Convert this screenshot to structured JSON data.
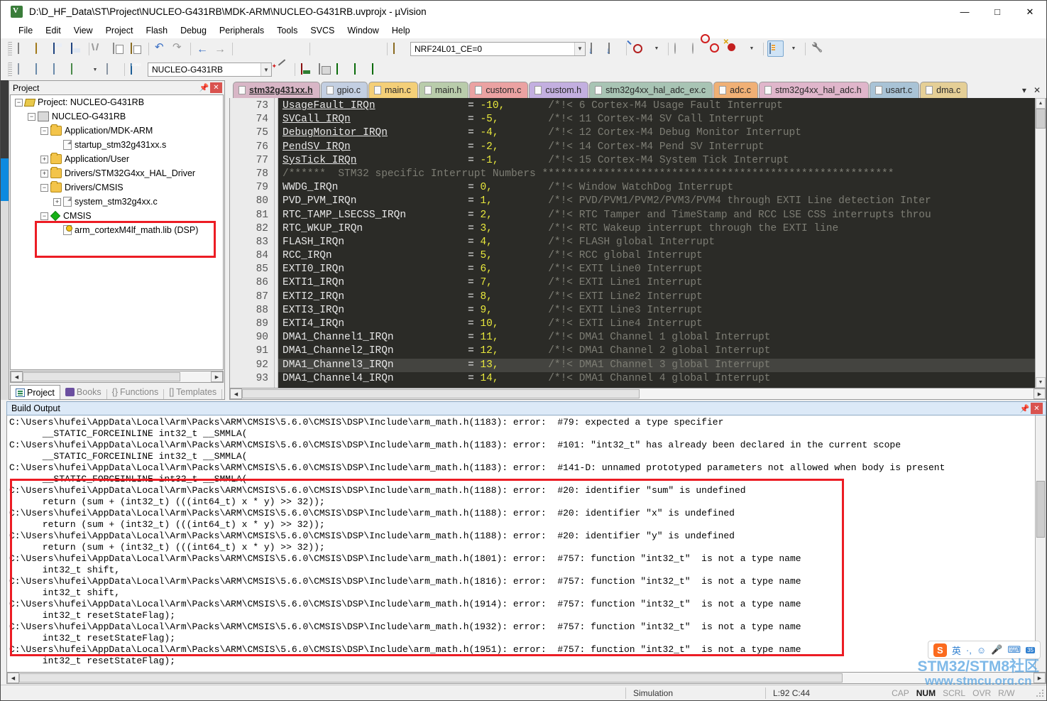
{
  "window": {
    "title": "D:\\D_HF_Data\\ST\\Project\\NUCLEO-G431RB\\MDK-ARM\\NUCLEO-G431RB.uvprojx - µVision",
    "minimize": "—",
    "maximize": "□",
    "close": "✕"
  },
  "menu": [
    {
      "label": "File"
    },
    {
      "label": "Edit"
    },
    {
      "label": "View"
    },
    {
      "label": "Project"
    },
    {
      "label": "Flash"
    },
    {
      "label": "Debug"
    },
    {
      "label": "Peripherals"
    },
    {
      "label": "Tools"
    },
    {
      "label": "SVCS"
    },
    {
      "label": "Window"
    },
    {
      "label": "Help"
    }
  ],
  "toolbar": {
    "target_combo_value": "NRF24L01_CE=0",
    "project_combo_value": "NUCLEO-G431RB",
    "arrow": "▼"
  },
  "project_pane": {
    "title": "Project",
    "pin_icon": "📌",
    "close_icon": "✕",
    "tree": [
      {
        "indent": 0,
        "toggle": "−",
        "icon": "project-icon",
        "label": "Project: NUCLEO-G431RB"
      },
      {
        "indent": 1,
        "toggle": "−",
        "icon": "projfolder-icon",
        "label": "NUCLEO-G431RB"
      },
      {
        "indent": 2,
        "toggle": "−",
        "icon": "folder-icon",
        "label": "Application/MDK-ARM"
      },
      {
        "indent": 3,
        "toggle": "",
        "icon": "file-icon",
        "label": "startup_stm32g431xx.s"
      },
      {
        "indent": 2,
        "toggle": "+",
        "icon": "folder-icon",
        "label": "Application/User"
      },
      {
        "indent": 2,
        "toggle": "+",
        "icon": "folder-icon",
        "label": "Drivers/STM32G4xx_HAL_Driver"
      },
      {
        "indent": 2,
        "toggle": "−",
        "icon": "folder-icon",
        "label": "Drivers/CMSIS"
      },
      {
        "indent": 3,
        "toggle": "+",
        "icon": "file-icon",
        "label": "system_stm32g4xx.c"
      },
      {
        "indent": 2,
        "toggle": "−",
        "icon": "diamond-icon",
        "label": "CMSIS"
      },
      {
        "indent": 3,
        "toggle": "",
        "icon": "lib-icon",
        "label": "arm_cortexM4lf_math.lib (DSP)"
      }
    ],
    "tabs": [
      {
        "label": "Project",
        "selected": true
      },
      {
        "label": "Books",
        "selected": false
      },
      {
        "label": "Functions",
        "selected": false
      },
      {
        "label": "Templates",
        "selected": false
      }
    ]
  },
  "editor": {
    "tabs": [
      {
        "label": "stm32g431xx.h",
        "color": "#d8b6c6",
        "selected": true
      },
      {
        "label": "gpio.c",
        "color": "#c3cfe2",
        "selected": false
      },
      {
        "label": "main.c",
        "color": "#f4cf78",
        "selected": false
      },
      {
        "label": "main.h",
        "color": "#b9ccab",
        "selected": false
      },
      {
        "label": "custom.c",
        "color": "#eba2a2",
        "selected": false
      },
      {
        "label": "custom.h",
        "color": "#c3afe0",
        "selected": false
      },
      {
        "label": "stm32g4xx_hal_adc_ex.c",
        "color": "#a8c4b4",
        "selected": false
      },
      {
        "label": "adc.c",
        "color": "#f0b075",
        "selected": false
      },
      {
        "label": "stm32g4xx_hal_adc.h",
        "color": "#e0b6cb",
        "selected": false
      },
      {
        "label": "usart.c",
        "color": "#a9c3d6",
        "selected": false
      },
      {
        "label": "dma.c",
        "color": "#e5cf96",
        "selected": false
      }
    ],
    "tab_overflow_icon": "▾",
    "tab_close_icon": "✕",
    "first_line_number": 73,
    "current_line": 92,
    "lines": [
      {
        "n": 73,
        "ident": "UsageFault_IRQn",
        "underline": true,
        "eq": "=",
        "num": "-10,",
        "comment": "/*!< 6 Cortex-M4 Usage Fault Interrupt"
      },
      {
        "n": 74,
        "ident": "SVCall_IRQn",
        "underline": true,
        "eq": "=",
        "num": "-5,",
        "comment": "/*!< 11 Cortex-M4 SV Call Interrupt"
      },
      {
        "n": 75,
        "ident": "DebugMonitor_IRQn",
        "underline": true,
        "eq": "=",
        "num": "-4,",
        "comment": "/*!< 12 Cortex-M4 Debug Monitor Interrupt"
      },
      {
        "n": 76,
        "ident": "PendSV_IRQn",
        "underline": true,
        "eq": "=",
        "num": "-2,",
        "comment": "/*!< 14 Cortex-M4 Pend SV Interrupt"
      },
      {
        "n": 77,
        "ident": "SysTick_IRQn",
        "underline": true,
        "eq": "=",
        "num": "-1,",
        "comment": "/*!< 15 Cortex-M4 System Tick Interrupt"
      },
      {
        "n": 78,
        "banner": "/******  STM32 specific Interrupt Numbers *********************************************************"
      },
      {
        "n": 79,
        "ident": "WWDG_IRQn",
        "underline": false,
        "eq": "=",
        "num": "0,",
        "comment": "/*!< Window WatchDog Interrupt"
      },
      {
        "n": 80,
        "ident": "PVD_PVM_IRQn",
        "underline": false,
        "eq": "=",
        "num": "1,",
        "comment": "/*!< PVD/PVM1/PVM2/PVM3/PVM4 through EXTI Line detection Inter"
      },
      {
        "n": 81,
        "ident": "RTC_TAMP_LSECSS_IRQn",
        "underline": false,
        "eq": "=",
        "num": "2,",
        "comment": "/*!< RTC Tamper and TimeStamp and RCC LSE CSS interrupts throu"
      },
      {
        "n": 82,
        "ident": "RTC_WKUP_IRQn",
        "underline": false,
        "eq": "=",
        "num": "3,",
        "comment": "/*!< RTC Wakeup interrupt through the EXTI line"
      },
      {
        "n": 83,
        "ident": "FLASH_IRQn",
        "underline": false,
        "eq": "=",
        "num": "4,",
        "comment": "/*!< FLASH global Interrupt"
      },
      {
        "n": 84,
        "ident": "RCC_IRQn",
        "underline": false,
        "eq": "=",
        "num": "5,",
        "comment": "/*!< RCC global Interrupt"
      },
      {
        "n": 85,
        "ident": "EXTI0_IRQn",
        "underline": false,
        "eq": "=",
        "num": "6,",
        "comment": "/*!< EXTI Line0 Interrupt"
      },
      {
        "n": 86,
        "ident": "EXTI1_IRQn",
        "underline": false,
        "eq": "=",
        "num": "7,",
        "comment": "/*!< EXTI Line1 Interrupt"
      },
      {
        "n": 87,
        "ident": "EXTI2_IRQn",
        "underline": false,
        "eq": "=",
        "num": "8,",
        "comment": "/*!< EXTI Line2 Interrupt"
      },
      {
        "n": 88,
        "ident": "EXTI3_IRQn",
        "underline": false,
        "eq": "=",
        "num": "9,",
        "comment": "/*!< EXTI Line3 Interrupt"
      },
      {
        "n": 89,
        "ident": "EXTI4_IRQn",
        "underline": false,
        "eq": "=",
        "num": "10,",
        "comment": "/*!< EXTI Line4 Interrupt"
      },
      {
        "n": 90,
        "ident": "DMA1_Channel1_IRQn",
        "underline": false,
        "eq": "=",
        "num": "11,",
        "comment": "/*!< DMA1 Channel 1 global Interrupt"
      },
      {
        "n": 91,
        "ident": "DMA1_Channel2_IRQn",
        "underline": false,
        "eq": "=",
        "num": "12,",
        "comment": "/*!< DMA1 Channel 2 global Interrupt"
      },
      {
        "n": 92,
        "ident": "DMA1_Channel3_IRQn",
        "underline": false,
        "eq": "=",
        "num": "13,",
        "comment": "/*!< DMA1 Channel 3 global Interrupt"
      },
      {
        "n": 93,
        "ident": "DMA1_Channel4_IRQn",
        "underline": false,
        "eq": "=",
        "num": "14,",
        "comment": "/*!< DMA1 Channel 4 global Interrupt"
      }
    ]
  },
  "build_output": {
    "title": "Build Output",
    "pin_icon": "📌",
    "close_icon": "✕",
    "lines": [
      "C:\\Users\\hufei\\AppData\\Local\\Arm\\Packs\\ARM\\CMSIS\\5.6.0\\CMSIS\\DSP\\Include\\arm_math.h(1183): error:  #79: expected a type specifier",
      "      __STATIC_FORCEINLINE int32_t __SMMLA(",
      "C:\\Users\\hufei\\AppData\\Local\\Arm\\Packs\\ARM\\CMSIS\\5.6.0\\CMSIS\\DSP\\Include\\arm_math.h(1183): error:  #101: \"int32_t\" has already been declared in the current scope",
      "      __STATIC_FORCEINLINE int32_t __SMMLA(",
      "C:\\Users\\hufei\\AppData\\Local\\Arm\\Packs\\ARM\\CMSIS\\5.6.0\\CMSIS\\DSP\\Include\\arm_math.h(1183): error:  #141-D: unnamed prototyped parameters not allowed when body is present",
      "      __STATIC_FORCEINLINE int32_t __SMMLA(",
      "C:\\Users\\hufei\\AppData\\Local\\Arm\\Packs\\ARM\\CMSIS\\5.6.0\\CMSIS\\DSP\\Include\\arm_math.h(1188): error:  #20: identifier \"sum\" is undefined",
      "      return (sum + (int32_t) (((int64_t) x * y) >> 32));",
      "C:\\Users\\hufei\\AppData\\Local\\Arm\\Packs\\ARM\\CMSIS\\5.6.0\\CMSIS\\DSP\\Include\\arm_math.h(1188): error:  #20: identifier \"x\" is undefined",
      "      return (sum + (int32_t) (((int64_t) x * y) >> 32));",
      "C:\\Users\\hufei\\AppData\\Local\\Arm\\Packs\\ARM\\CMSIS\\5.6.0\\CMSIS\\DSP\\Include\\arm_math.h(1188): error:  #20: identifier \"y\" is undefined",
      "      return (sum + (int32_t) (((int64_t) x * y) >> 32));",
      "C:\\Users\\hufei\\AppData\\Local\\Arm\\Packs\\ARM\\CMSIS\\5.6.0\\CMSIS\\DSP\\Include\\arm_math.h(1801): error:  #757: function \"int32_t\"  is not a type name",
      "      int32_t shift,",
      "C:\\Users\\hufei\\AppData\\Local\\Arm\\Packs\\ARM\\CMSIS\\5.6.0\\CMSIS\\DSP\\Include\\arm_math.h(1816): error:  #757: function \"int32_t\"  is not a type name",
      "      int32_t shift,",
      "C:\\Users\\hufei\\AppData\\Local\\Arm\\Packs\\ARM\\CMSIS\\5.6.0\\CMSIS\\DSP\\Include\\arm_math.h(1914): error:  #757: function \"int32_t\"  is not a type name",
      "      int32_t resetStateFlag);",
      "C:\\Users\\hufei\\AppData\\Local\\Arm\\Packs\\ARM\\CMSIS\\5.6.0\\CMSIS\\DSP\\Include\\arm_math.h(1932): error:  #757: function \"int32_t\"  is not a type name",
      "      int32_t resetStateFlag);",
      "C:\\Users\\hufei\\AppData\\Local\\Arm\\Packs\\ARM\\CMSIS\\5.6.0\\CMSIS\\DSP\\Include\\arm_math.h(1951): error:  #757: function \"int32_t\"  is not a type name",
      "      int32_t resetStateFlag);"
    ]
  },
  "status_bar": {
    "mode": "Simulation",
    "cursor": "L:92 C:44",
    "indicators": [
      {
        "label": "CAP",
        "active": false
      },
      {
        "label": "NUM",
        "active": true
      },
      {
        "label": "SCRL",
        "active": false
      },
      {
        "label": "OVR",
        "active": false
      },
      {
        "label": "R/W",
        "active": false
      }
    ]
  },
  "watermark": {
    "line1": "STM32/STM8社区",
    "line2": "www.stmcu.org.cn"
  },
  "ime": {
    "logo": "S",
    "mode": "英",
    "punct": "·,",
    "emoji": "☺",
    "mic": "🎤",
    "keyboard": "⌨",
    "badge": "35",
    "expand": "›"
  },
  "colors": {
    "highlight_box": "#ec1c24",
    "editor_bg": "#2b2b27",
    "editor_number": "#e8e83c",
    "editor_comment": "#7d7d74",
    "accent_blue": "#0d8ae0"
  }
}
